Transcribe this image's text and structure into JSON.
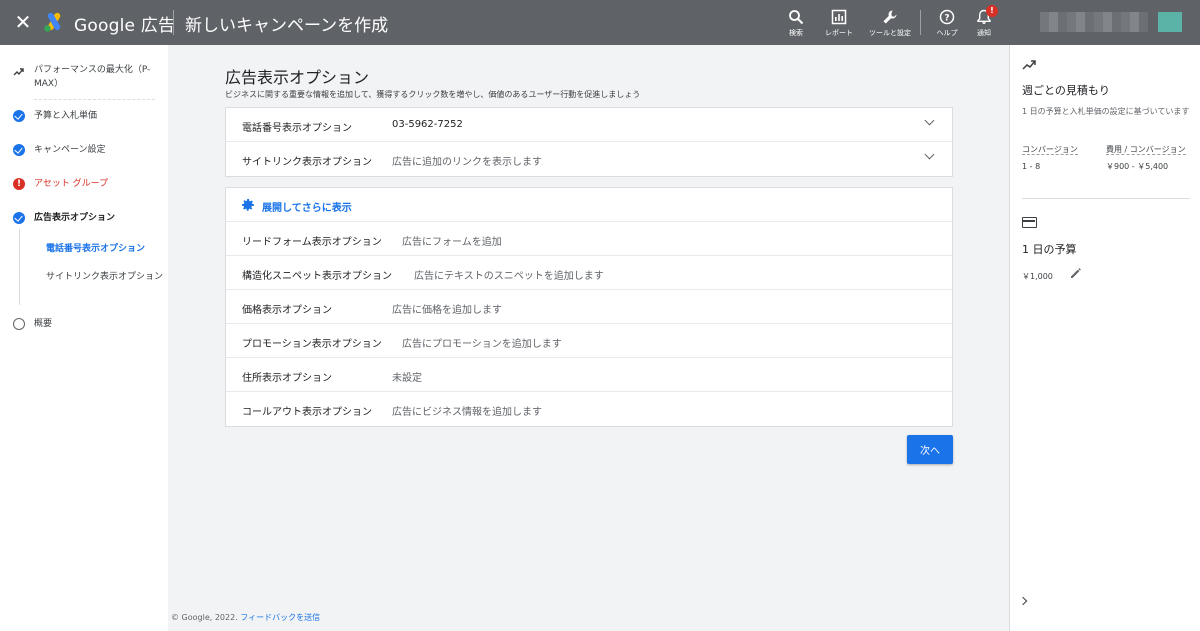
{
  "topbar": {
    "brand": "Google 広告",
    "title": "新しいキャンペーンを作成",
    "tools": [
      {
        "label": "検索",
        "icon": "search-icon"
      },
      {
        "label": "レポート",
        "icon": "report-icon"
      },
      {
        "label": "ツールと設定",
        "icon": "wrench-icon"
      },
      {
        "label": "ヘルプ",
        "icon": "help-icon"
      },
      {
        "label": "通知",
        "icon": "bell-icon"
      }
    ],
    "notification_badge": "!",
    "colors": {
      "bar": "#5f6368",
      "accent": "#1a73e8",
      "error": "#d93025"
    }
  },
  "leftnav": {
    "items": [
      {
        "label": "パフォーマンスの最大化（P-MAX）",
        "status": "trend"
      },
      {
        "label": "予算と入札単価",
        "status": "complete"
      },
      {
        "label": "キャンペーン設定",
        "status": "complete"
      },
      {
        "label": "アセット グループ",
        "status": "error"
      },
      {
        "label": "広告表示オプション",
        "status": "complete"
      },
      {
        "label": "概要",
        "status": "incomplete"
      }
    ],
    "subitems": [
      {
        "label": "電話番号表示オプション",
        "active": true
      },
      {
        "label": "サイトリンク表示オプション",
        "active": false
      }
    ]
  },
  "main": {
    "title": "広告表示オプション",
    "subtitle": "ビジネスに関する重要な情報を追加して、獲得するクリック数を増やし、価値のあるユーザー行動を促進しましょう",
    "primary": [
      {
        "label": "電話番号表示オプション",
        "value": "03-5962-7252"
      },
      {
        "label": "サイトリンク表示オプション",
        "value": "広告に追加のリンクを表示します"
      }
    ],
    "expand_label": "展開してさらに表示",
    "secondary": [
      {
        "label": "リードフォーム表示オプション",
        "value": "広告にフォームを追加"
      },
      {
        "label": "構造化スニペット表示オプション",
        "value": "広告にテキストのスニペットを追加します"
      },
      {
        "label": "価格表示オプション",
        "value": "広告に価格を追加します"
      },
      {
        "label": "プロモーション表示オプション",
        "value": "広告にプロモーションを追加します"
      },
      {
        "label": "住所表示オプション",
        "value": "未設定"
      },
      {
        "label": "コールアウト表示オプション",
        "value": "広告にビジネス情報を追加します"
      }
    ],
    "next_label": "次へ"
  },
  "footer": {
    "copyright": "© Google, 2022.",
    "feedback": "フィードバックを送信"
  },
  "rightpanel": {
    "title": "週ごとの見積もり",
    "desc": "1 日の予算と入札単価の設定に基づいています",
    "conv_label": "コンバージョン",
    "conv_value": "1 - 8",
    "cost_label": "費用 / コンバージョン",
    "cost_value": "￥900 - ￥5,400",
    "budget_title": "1 日の予算",
    "budget_value": "￥1,000"
  }
}
